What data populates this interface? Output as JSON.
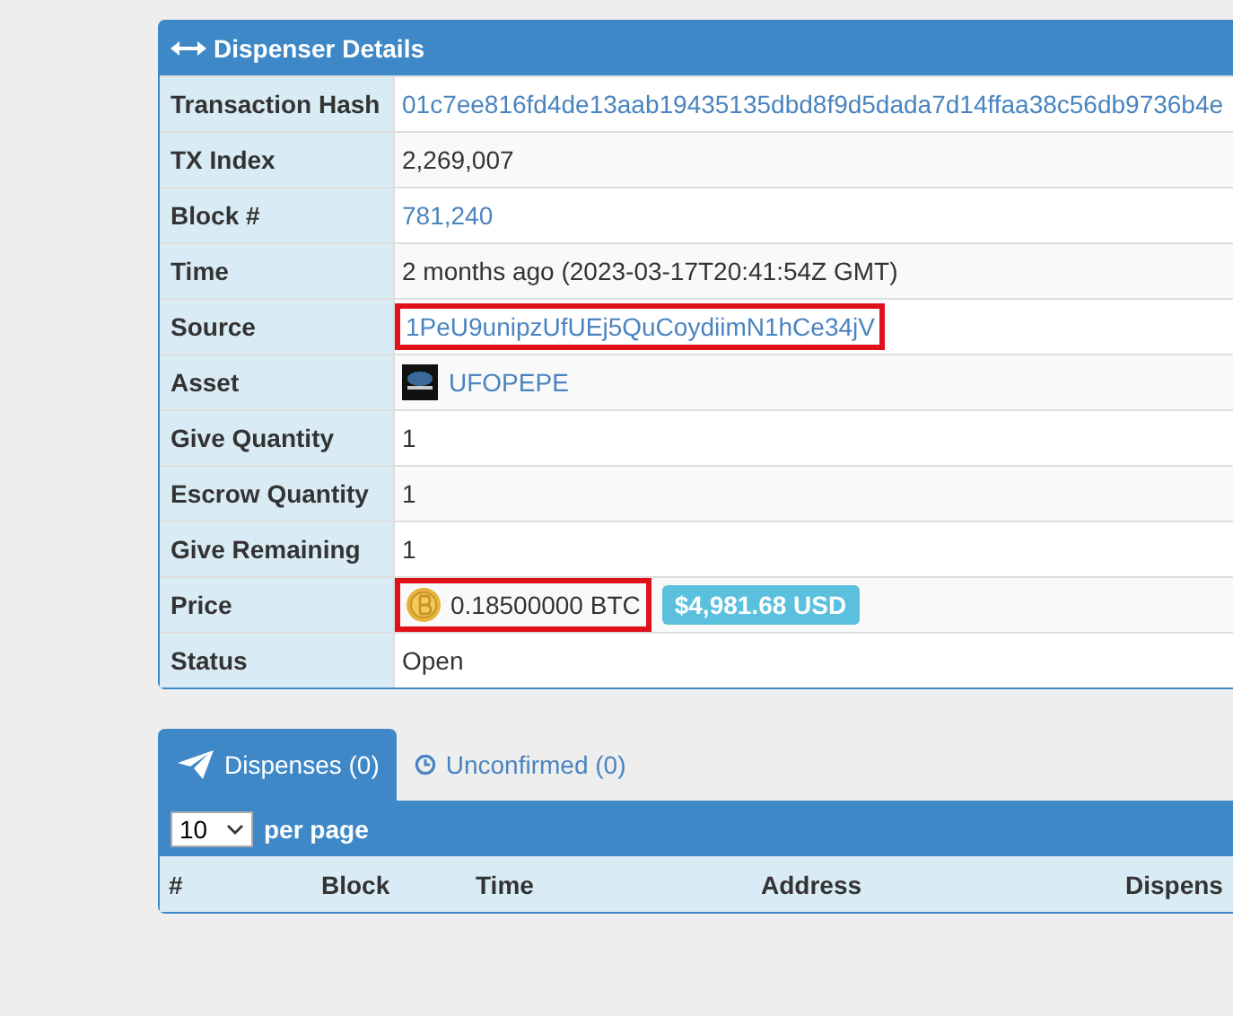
{
  "panel": {
    "title": "Dispenser Details"
  },
  "details": [
    {
      "label": "Transaction Hash",
      "kind": "link",
      "value": "01c7ee816fd4de13aab19435135dbd8f9d5dada7d14ffaa38c56db9736b4e",
      "highlighted": false
    },
    {
      "label": "TX Index",
      "kind": "text",
      "value": "2,269,007",
      "highlighted": false
    },
    {
      "label": "Block #",
      "kind": "link",
      "value": "781,240",
      "highlighted": false
    },
    {
      "label": "Time",
      "kind": "text",
      "value": "2 months ago (2023-03-17T20:41:54Z GMT)",
      "highlighted": false
    },
    {
      "label": "Source",
      "kind": "link",
      "value": "1PeU9unipzUfUEj5QuCoydiimN1hCe34jV",
      "highlighted": true
    },
    {
      "label": "Asset",
      "kind": "asset",
      "value": "UFOPEPE",
      "highlighted": false
    },
    {
      "label": "Give Quantity",
      "kind": "text",
      "value": "1",
      "highlighted": false
    },
    {
      "label": "Escrow Quantity",
      "kind": "text",
      "value": "1",
      "highlighted": false
    },
    {
      "label": "Give Remaining",
      "kind": "text",
      "value": "1",
      "highlighted": false
    },
    {
      "label": "Price",
      "kind": "price",
      "value": "0.18500000 BTC",
      "badge": "$4,981.68 USD",
      "highlighted": true
    },
    {
      "label": "Status",
      "kind": "text",
      "value": "Open",
      "highlighted": false
    }
  ],
  "tabs": [
    {
      "label": "Dispenses (0)",
      "selected": true
    },
    {
      "label": "Unconfirmed (0)",
      "selected": false
    }
  ],
  "page_size": {
    "value": "10",
    "label": "per page"
  },
  "table": {
    "columns": [
      "#",
      "Block",
      "Time",
      "Address",
      "Dispens"
    ]
  }
}
